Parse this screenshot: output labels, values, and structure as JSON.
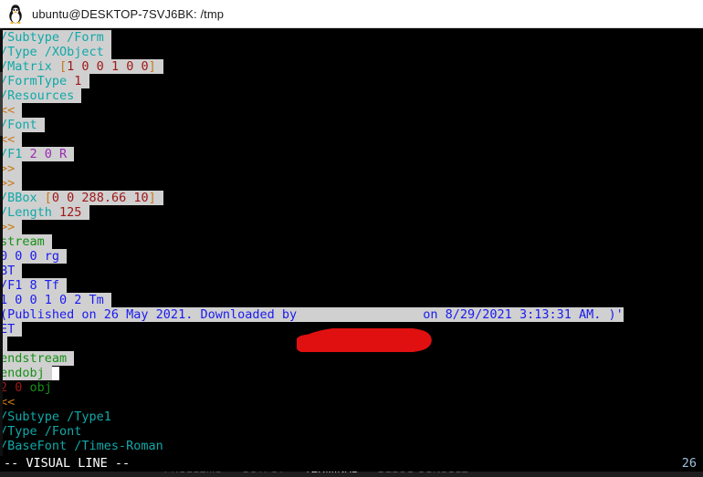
{
  "window": {
    "title": "ubuntu@DESKTOP-7SVJ6BK: /tmp",
    "icon": "tux-penguin-icon"
  },
  "colors": {
    "terminal_background": "#000000",
    "selection_highlight": "#d0d0d0",
    "key_teal": "#11a8a8",
    "bracket_orange": "#c87a1a",
    "number_darkred": "#a01818",
    "reference_purple": "#9b29b5",
    "string_blue": "#1a1af0",
    "keyword_green": "#179017",
    "redaction_red": "#e01010",
    "panel_background": "#1e1e1e"
  },
  "terminal": {
    "lines": [
      {
        "selected": true,
        "sel_pad": 1,
        "tokens": [
          {
            "t": "/Subtype /Form",
            "c": "c-key"
          }
        ]
      },
      {
        "selected": true,
        "sel_pad": 1,
        "tokens": [
          {
            "t": "/Type /XObject",
            "c": "c-key"
          }
        ]
      },
      {
        "selected": true,
        "sel_pad": 1,
        "tokens": [
          {
            "t": "/Matrix ",
            "c": "c-key"
          },
          {
            "t": "[",
            "c": "c-brk"
          },
          {
            "t": "1 0 0 1 0 0",
            "c": "c-num"
          },
          {
            "t": "]",
            "c": "c-brk"
          }
        ]
      },
      {
        "selected": true,
        "sel_pad": 1,
        "tokens": [
          {
            "t": "/FormType ",
            "c": "c-key"
          },
          {
            "t": "1",
            "c": "c-num"
          }
        ]
      },
      {
        "selected": true,
        "sel_pad": 1,
        "tokens": [
          {
            "t": "/Resources",
            "c": "c-key"
          }
        ]
      },
      {
        "selected": true,
        "sel_pad": 1,
        "tokens": [
          {
            "t": "<<",
            "c": "c-brk"
          }
        ]
      },
      {
        "selected": true,
        "sel_pad": 1,
        "tokens": [
          {
            "t": "/Font",
            "c": "c-key"
          }
        ]
      },
      {
        "selected": true,
        "sel_pad": 1,
        "tokens": [
          {
            "t": "<<",
            "c": "c-brk"
          }
        ]
      },
      {
        "selected": true,
        "sel_pad": 1,
        "tokens": [
          {
            "t": "/F1 ",
            "c": "c-key"
          },
          {
            "t": "2 0 R",
            "c": "c-ref"
          }
        ]
      },
      {
        "selected": true,
        "sel_pad": 1,
        "tokens": [
          {
            "t": ">>",
            "c": "c-brk"
          }
        ]
      },
      {
        "selected": true,
        "sel_pad": 1,
        "tokens": [
          {
            "t": ">>",
            "c": "c-brk"
          }
        ]
      },
      {
        "selected": true,
        "sel_pad": 1,
        "tokens": [
          {
            "t": "/BBox ",
            "c": "c-key"
          },
          {
            "t": "[",
            "c": "c-brk"
          },
          {
            "t": "0 0 288.66 10",
            "c": "c-num"
          },
          {
            "t": "]",
            "c": "c-brk"
          }
        ]
      },
      {
        "selected": true,
        "sel_pad": 1,
        "tokens": [
          {
            "t": "/Length ",
            "c": "c-key"
          },
          {
            "t": "125",
            "c": "c-num"
          }
        ]
      },
      {
        "selected": true,
        "sel_pad": 1,
        "tokens": [
          {
            "t": ">>",
            "c": "c-brk"
          }
        ]
      },
      {
        "selected": true,
        "sel_pad": 1,
        "tokens": [
          {
            "t": "stream",
            "c": "c-green"
          }
        ]
      },
      {
        "selected": true,
        "sel_pad": 1,
        "tokens": [
          {
            "t": "0 0 0 rg",
            "c": "c-str"
          }
        ]
      },
      {
        "selected": true,
        "sel_pad": 1,
        "tokens": [
          {
            "t": "BT",
            "c": "c-str"
          }
        ]
      },
      {
        "selected": true,
        "sel_pad": 1,
        "tokens": [
          {
            "t": "/F1 8 Tf",
            "c": "c-str"
          }
        ]
      },
      {
        "selected": true,
        "sel_pad": 1,
        "tokens": [
          {
            "t": "1 0 0 1 0 2 Tm",
            "c": "c-str"
          }
        ]
      },
      {
        "selected": true,
        "sel_pad": 0,
        "tokens": [
          {
            "t": "(Published on 26 May 2021. Downloaded by                 on 8/29/2021 3:13:31 AM. )'",
            "c": "c-str"
          }
        ]
      },
      {
        "selected": true,
        "sel_pad": 1,
        "tokens": [
          {
            "t": "ET",
            "c": "c-str"
          }
        ]
      },
      {
        "selected": true,
        "sel_pad": 1,
        "tokens": [
          {
            "t": "",
            "c": "c-str"
          }
        ]
      },
      {
        "selected": true,
        "sel_pad": 1,
        "tokens": [
          {
            "t": "endstream",
            "c": "c-green"
          }
        ]
      },
      {
        "selected": true,
        "sel_pad": 1,
        "cursor": true,
        "tokens": [
          {
            "t": "endobj",
            "c": "c-green"
          }
        ]
      },
      {
        "selected": false,
        "sel_pad": 0,
        "tokens": [
          {
            "t": "2 0 ",
            "c": "c-obj"
          },
          {
            "t": "obj",
            "c": "c-green"
          }
        ]
      },
      {
        "selected": false,
        "sel_pad": 0,
        "tokens": [
          {
            "t": "<<",
            "c": "c-brk"
          }
        ]
      },
      {
        "selected": false,
        "sel_pad": 0,
        "tokens": [
          {
            "t": "/Subtype /Type1",
            "c": "c-key"
          }
        ]
      },
      {
        "selected": false,
        "sel_pad": 0,
        "tokens": [
          {
            "t": "/Type /Font",
            "c": "c-key"
          }
        ]
      },
      {
        "selected": false,
        "sel_pad": 0,
        "tokens": [
          {
            "t": "/BaseFont /Times-Roman",
            "c": "c-key"
          }
        ]
      }
    ],
    "status": {
      "mode": "-- VISUAL LINE --",
      "count": "26"
    },
    "redaction": {
      "label": "red-marker-redaction",
      "color": "#e01010"
    }
  },
  "panel": {
    "tabs": [
      {
        "label": "PROBLEMS",
        "active": false
      },
      {
        "label": "OUTPUT",
        "active": false
      },
      {
        "label": "TERMINAL",
        "active": true
      },
      {
        "label": "DEBUG CONSOLE",
        "active": false
      }
    ]
  }
}
